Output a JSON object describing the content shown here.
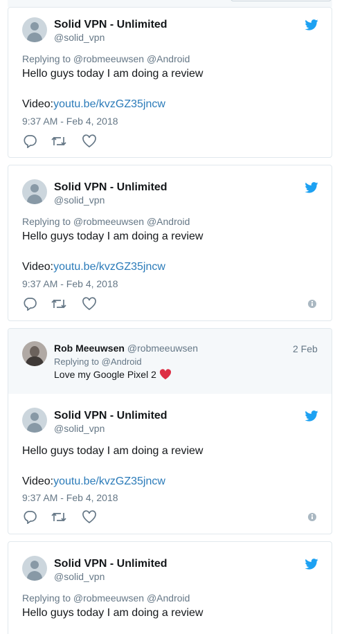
{
  "colors": {
    "link": "#2b7bb9",
    "muted": "#657786",
    "twitter_blue": "#1da1f2",
    "border": "#e1e8ed",
    "parent_bg": "#f5f8fa",
    "heart": "#dd2e44"
  },
  "tweets": [
    {
      "name": "Solid VPN - Unlimited",
      "handle": "@solid_vpn",
      "replying": "Replying to @robmeeuwsen @Android",
      "text": "Hello guys today I am doing a review",
      "video_prefix": "Video:",
      "video_link": "youtu.be/kvzGZ35jncw",
      "time": "9:37 AM - Feb 4, 2018"
    },
    {
      "name": "Solid VPN - Unlimited",
      "handle": "@solid_vpn",
      "replying": "Replying to @robmeeuwsen @Android",
      "text": "Hello guys today I am doing a review",
      "video_prefix": "Video:",
      "video_link": "youtu.be/kvzGZ35jncw",
      "time": "9:37 AM - Feb 4, 2018"
    },
    {
      "name": "Solid VPN - Unlimited",
      "handle": "@solid_vpn",
      "text": "Hello guys today I am doing a review",
      "video_prefix": "Video:",
      "video_link": "youtu.be/kvzGZ35jncw",
      "time": "9:37 AM - Feb 4, 2018"
    },
    {
      "name": "Solid VPN - Unlimited",
      "handle": "@solid_vpn",
      "replying": "Replying to @robmeeuwsen @Android",
      "text": "Hello guys today I am doing a review"
    }
  ],
  "parent_tweet": {
    "name": "Rob Meeuwsen",
    "handle": "@robmeeuwsen",
    "date": "2 Feb",
    "replying": "Replying to @Android",
    "text": "Love my Google Pixel 2"
  },
  "icons": {
    "reply": "reply-icon",
    "retweet": "retweet-icon",
    "like": "heart-outline-icon",
    "info": "info-circle-icon",
    "bird": "twitter-bird-icon",
    "emoji": "red-heart-emoji-icon"
  }
}
